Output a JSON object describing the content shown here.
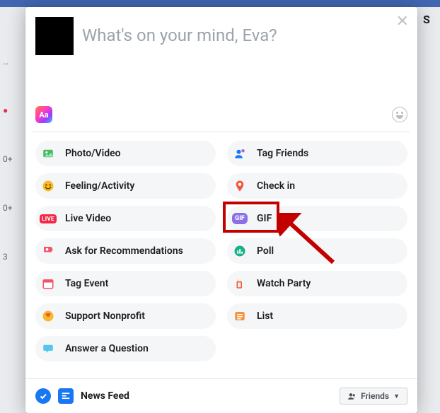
{
  "composer": {
    "placeholder": "What's on your mind, Eva?"
  },
  "options": [
    {
      "id": "photo-video",
      "label": "Photo/Video",
      "icon": "photo-icon",
      "bg": "#45bd62"
    },
    {
      "id": "tag-friends",
      "label": "Tag Friends",
      "icon": "tag-friends-icon",
      "bg": "#1877f2"
    },
    {
      "id": "feeling-activity",
      "label": "Feeling/Activity",
      "icon": "feeling-icon",
      "bg": "#f7b928"
    },
    {
      "id": "check-in",
      "label": "Check in",
      "icon": "checkin-icon",
      "bg": "#f5533d"
    },
    {
      "id": "live-video",
      "label": "Live Video",
      "icon": "live-icon",
      "bg": "#f02849",
      "badge": "LIVE"
    },
    {
      "id": "gif",
      "label": "GIF",
      "icon": "gif-icon",
      "bg": "#8a6fe6",
      "badge": "GIF"
    },
    {
      "id": "recommendations",
      "label": "Ask for Recommendations",
      "icon": "recommend-icon",
      "bg": "#f35369"
    },
    {
      "id": "poll",
      "label": "Poll",
      "icon": "poll-icon",
      "bg": "#1bb08b"
    },
    {
      "id": "tag-event",
      "label": "Tag Event",
      "icon": "event-icon",
      "bg": "#f35369"
    },
    {
      "id": "watch-party",
      "label": "Watch Party",
      "icon": "watch-party-icon",
      "bg": "#f7b928"
    },
    {
      "id": "support-nonprofit",
      "label": "Support Nonprofit",
      "icon": "nonprofit-icon",
      "bg": "#f7b928"
    },
    {
      "id": "list",
      "label": "List",
      "icon": "list-icon",
      "bg": "#f7923b"
    },
    {
      "id": "answer-question",
      "label": "Answer a Question",
      "icon": "question-icon",
      "bg": "#54c7ec"
    }
  ],
  "footer": {
    "feed_label": "News Feed",
    "privacy_label": "Friends"
  },
  "annotation": {
    "highlight_target": "gif",
    "highlight_color": "#c20000"
  },
  "side_hints": {
    "left": [
      "…",
      "●",
      "0+",
      "0+",
      "3"
    ],
    "right_top": "S"
  }
}
